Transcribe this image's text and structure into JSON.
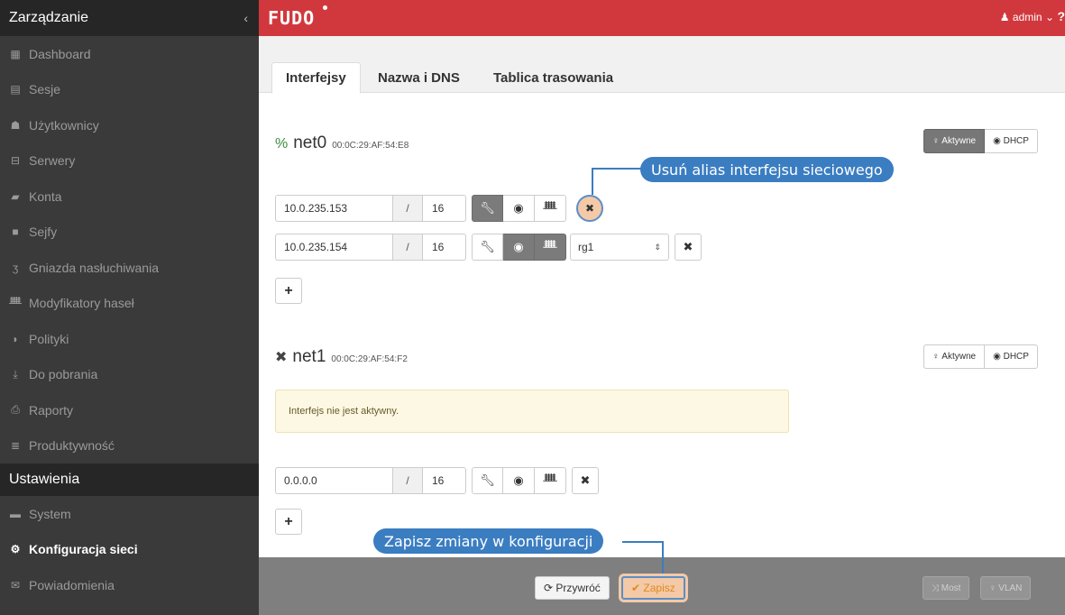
{
  "sidebar": {
    "title": "Zarządzanie",
    "collapse_icon": "chevron-left-icon",
    "items": [
      {
        "label": "Dashboard",
        "icon": "dashboard-icon"
      },
      {
        "label": "Sesje",
        "icon": "film-icon"
      },
      {
        "label": "Użytkownicy",
        "icon": "users-icon"
      },
      {
        "label": "Serwery",
        "icon": "server-icon"
      },
      {
        "label": "Konta",
        "icon": "user-card-icon"
      },
      {
        "label": "Sejfy",
        "icon": "safe-icon"
      },
      {
        "label": "Gniazda nasłuchiwania",
        "icon": "rss-icon"
      },
      {
        "label": "Modyfikatory haseł",
        "icon": "sitemap-icon"
      },
      {
        "label": "Polityki",
        "icon": "shield-icon"
      },
      {
        "label": "Do pobrania",
        "icon": "download-icon"
      },
      {
        "label": "Raporty",
        "icon": "print-icon"
      },
      {
        "label": "Produktywność",
        "icon": "list-icon"
      }
    ],
    "section2": "Ustawienia",
    "items2": [
      {
        "label": "System",
        "icon": "folder-icon"
      },
      {
        "label": "Konfiguracja sieci",
        "icon": "cogs-icon"
      },
      {
        "label": "Powiadomienia",
        "icon": "envelope-icon"
      }
    ]
  },
  "topbar": {
    "logo": "FUDO",
    "user": "admin",
    "help": "?",
    "brand_color": "#d1383d"
  },
  "tabs": [
    "Interfejsy",
    "Nazwa i DNS",
    "Tablica trasowania"
  ],
  "interfaces": [
    {
      "name": "net0",
      "mac": "00:0C:29:AF:54:E8",
      "status_icon": "link-icon",
      "active_label": "Aktywne",
      "dhcp_label": "DHCP",
      "rows": [
        {
          "ip": "10.0.235.153",
          "mask": "16",
          "slash": "/"
        },
        {
          "ip": "10.0.235.154",
          "mask": "16",
          "slash": "/",
          "select": "rg1"
        }
      ],
      "add": "+"
    },
    {
      "name": "net1",
      "mac": "00:0C:29:AF:54:F2",
      "status_icon": "unlink-icon",
      "active_label": "Aktywne",
      "dhcp_label": "DHCP",
      "warning": "Interfejs nie jest aktywny.",
      "rows": [
        {
          "ip": "0.0.0.0",
          "mask": "16",
          "slash": "/"
        }
      ],
      "add": "+"
    }
  ],
  "footer": {
    "revert": "Przywróć",
    "save": "Zapisz",
    "bridge": "Most",
    "vlan": "VLAN"
  },
  "callouts": {
    "remove_alias": "Usuń alias interfejsu sieciowego",
    "save_changes": "Zapisz zmiany w konfiguracji"
  }
}
